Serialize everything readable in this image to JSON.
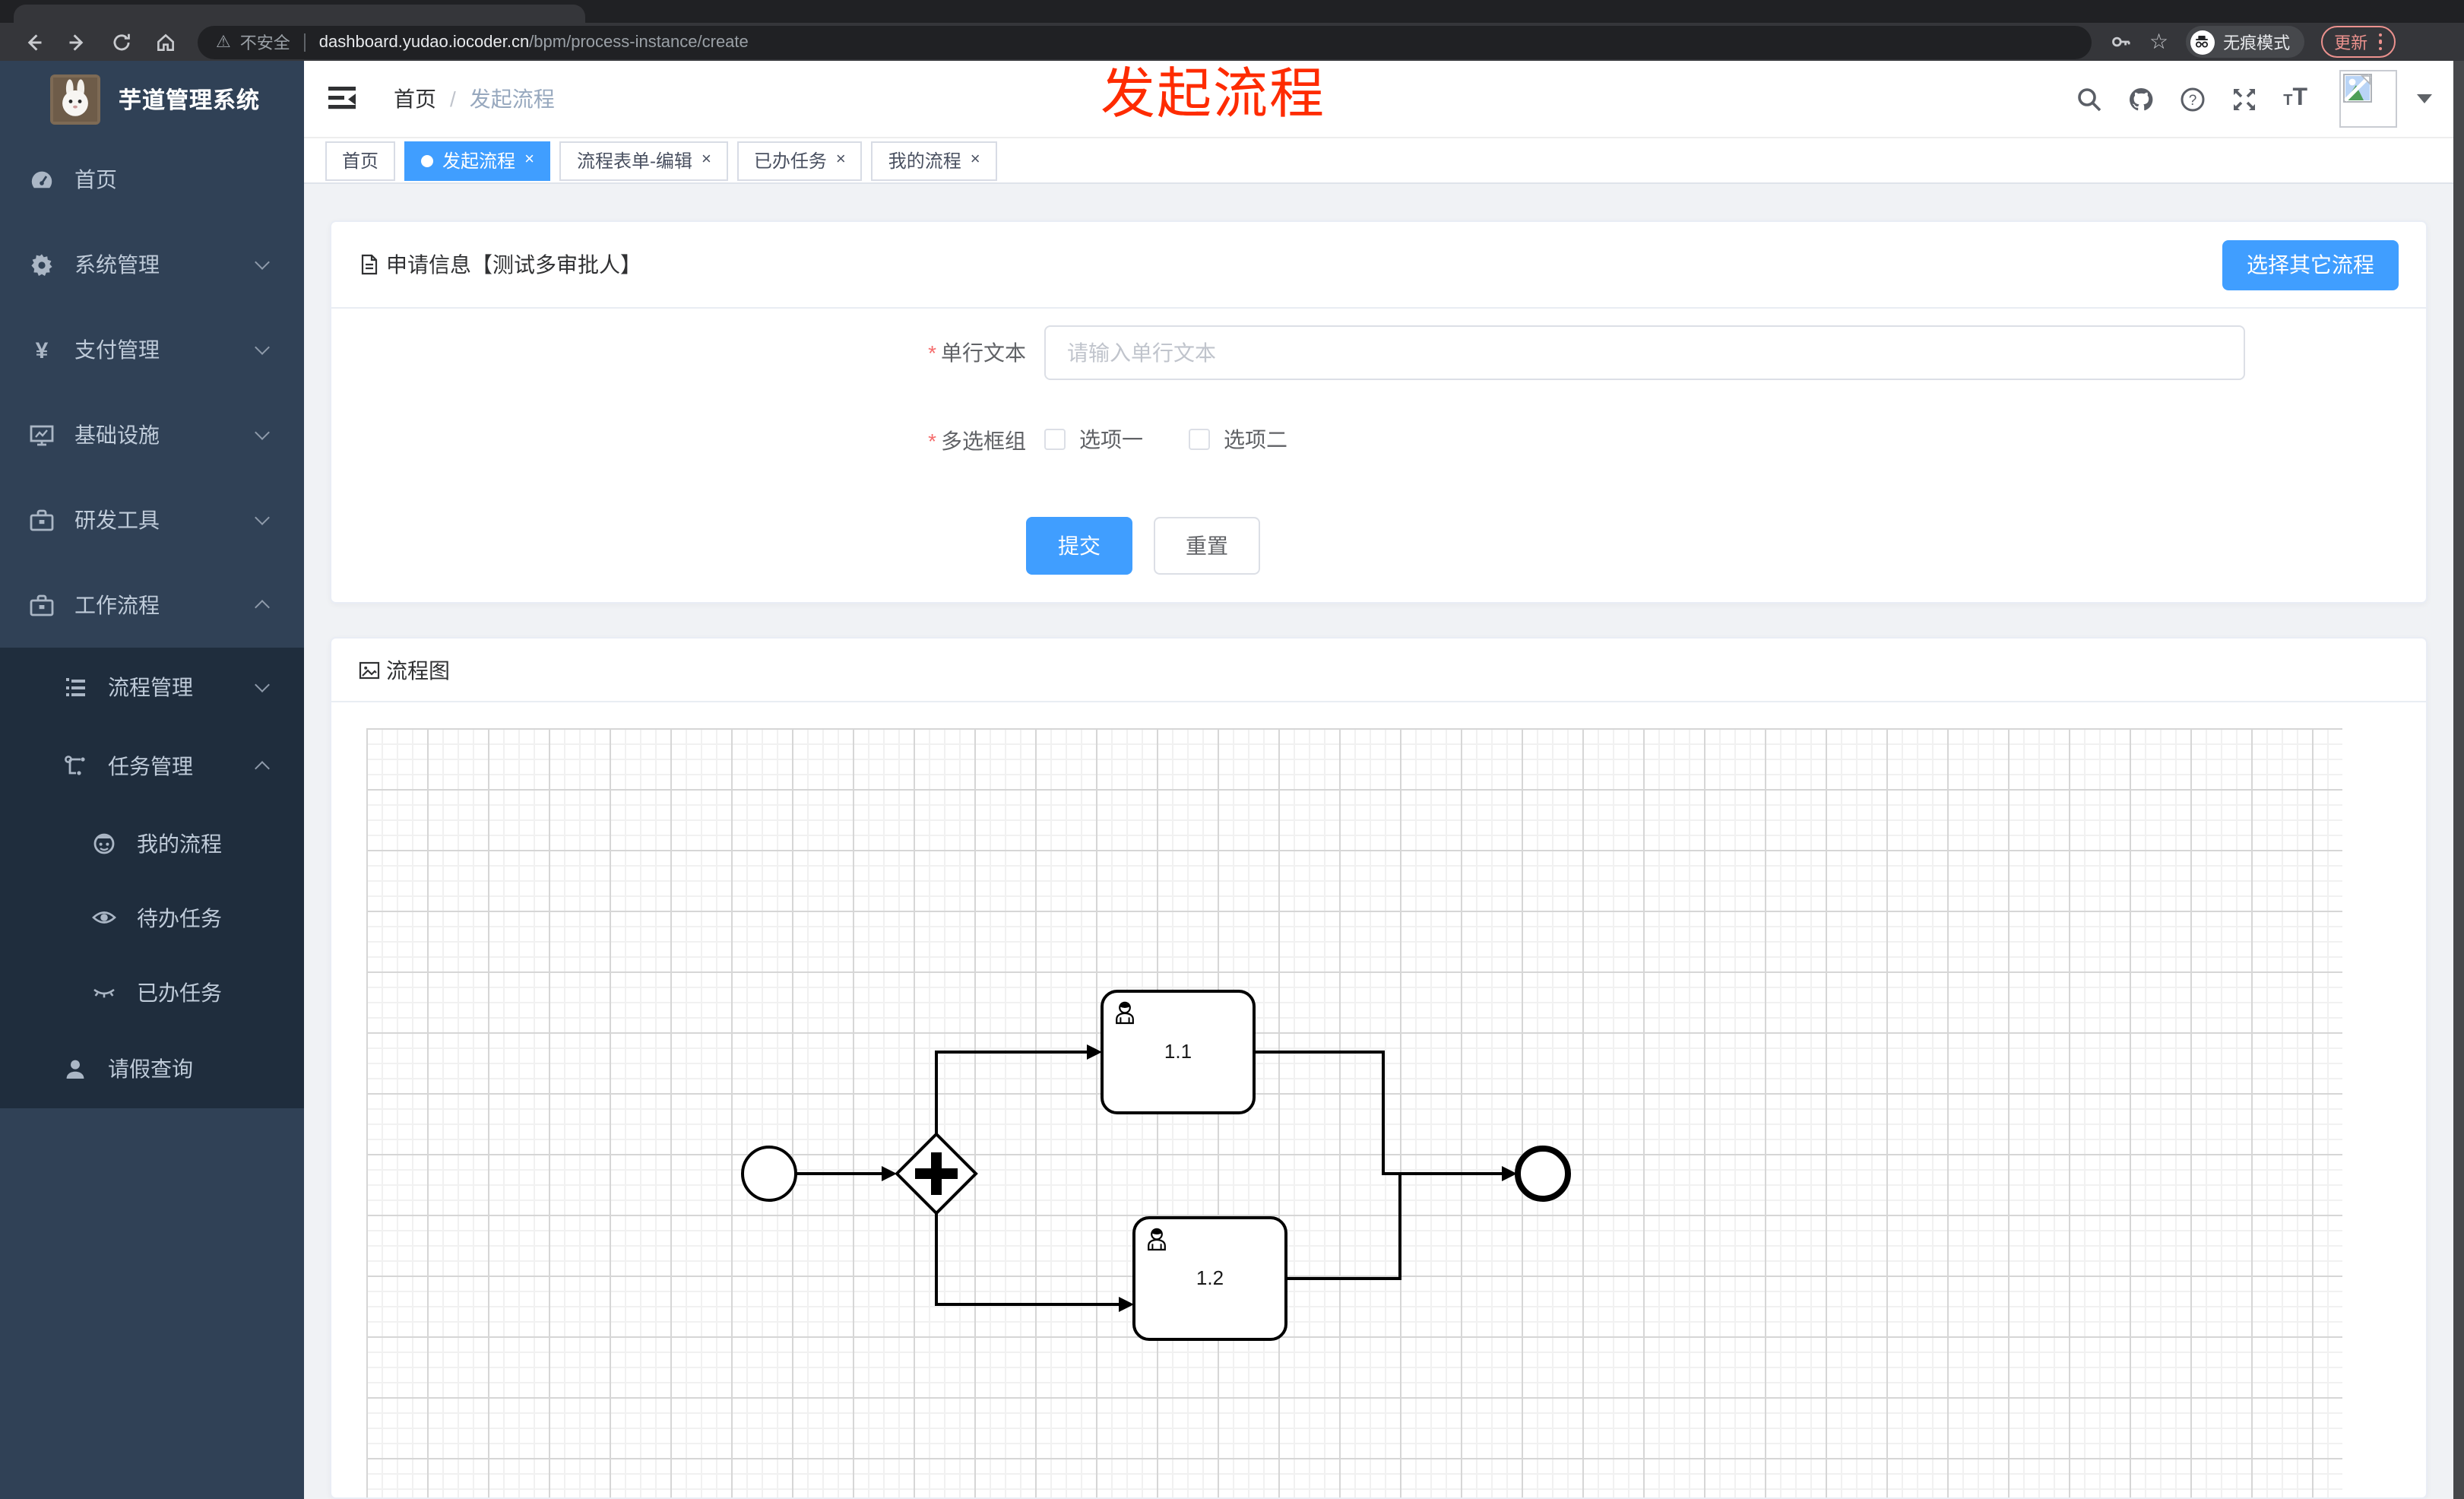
{
  "browser": {
    "security_label": "不安全",
    "url_domain": "dashboard.yudao.iocoder.cn",
    "url_path": "/bpm/process-instance/create",
    "incognito_label": "无痕模式",
    "update_label": "更新"
  },
  "sidebar": {
    "title": "芋道管理系统",
    "menu_top": [
      {
        "label": "首页",
        "icon": "dashboard",
        "level": 0
      },
      {
        "label": "系统管理",
        "icon": "gear",
        "level": 0,
        "chevron": "down"
      },
      {
        "label": "支付管理",
        "icon": "yen",
        "level": 0,
        "chevron": "down"
      },
      {
        "label": "基础设施",
        "icon": "monitor",
        "level": 0,
        "chevron": "down"
      },
      {
        "label": "研发工具",
        "icon": "toolbox",
        "level": 0,
        "chevron": "down"
      },
      {
        "label": "工作流程",
        "icon": "toolbox",
        "level": 0,
        "chevron": "up"
      }
    ],
    "menu_sub": [
      {
        "label": "流程管理",
        "icon": "list-tree",
        "level": 1,
        "chevron": "down"
      },
      {
        "label": "任务管理",
        "icon": "flow",
        "level": 1,
        "chevron": "up"
      },
      {
        "label": "我的流程",
        "icon": "robot",
        "level": 2
      },
      {
        "label": "待办任务",
        "icon": "eye",
        "level": 2
      },
      {
        "label": "已办任务",
        "icon": "eye-closed",
        "level": 2
      },
      {
        "label": "请假查询",
        "icon": "user",
        "level": 1
      }
    ]
  },
  "header": {
    "breadcrumb_home": "首页",
    "breadcrumb_sep": "/",
    "breadcrumb_current": "发起流程",
    "action_icons": [
      "search",
      "github",
      "help",
      "fullscreen",
      "font-size",
      "avatar",
      "caret-down"
    ]
  },
  "annotation": {
    "text": "发起流程",
    "color": "#fe2b00"
  },
  "tabs": [
    {
      "label": "首页"
    },
    {
      "label": "发起流程",
      "active": true,
      "closable": true,
      "close": "×"
    },
    {
      "label": "流程表单-编辑",
      "closable": true,
      "close": "×"
    },
    {
      "label": "已办任务",
      "closable": true,
      "close": "×"
    },
    {
      "label": "我的流程",
      "closable": true,
      "close": "×"
    }
  ],
  "form_card": {
    "title": "申请信息【测试多审批人】",
    "choose_other_button": "选择其它流程",
    "required_mark": "*",
    "single_line": {
      "label": "单行文本",
      "placeholder": "请输入单行文本"
    },
    "checkbox_group": {
      "label": "多选框组",
      "options": [
        {
          "label": "选项一"
        },
        {
          "label": "选项二"
        }
      ]
    },
    "submit_label": "提交",
    "reset_label": "重置"
  },
  "flow_card": {
    "title": "流程图",
    "bpmn": {
      "task1": "1.1",
      "task2": "1.2",
      "elements": [
        "start-event",
        "parallel-gateway",
        "user-task-1.1",
        "user-task-1.2",
        "end-event"
      ]
    }
  },
  "colors": {
    "primary": "#409eff",
    "sidebar_bg": "#304156",
    "sidebar_submenu_bg": "#1f2d3d",
    "annotation_red": "#fe2b00",
    "active_tab": "#409eff"
  }
}
